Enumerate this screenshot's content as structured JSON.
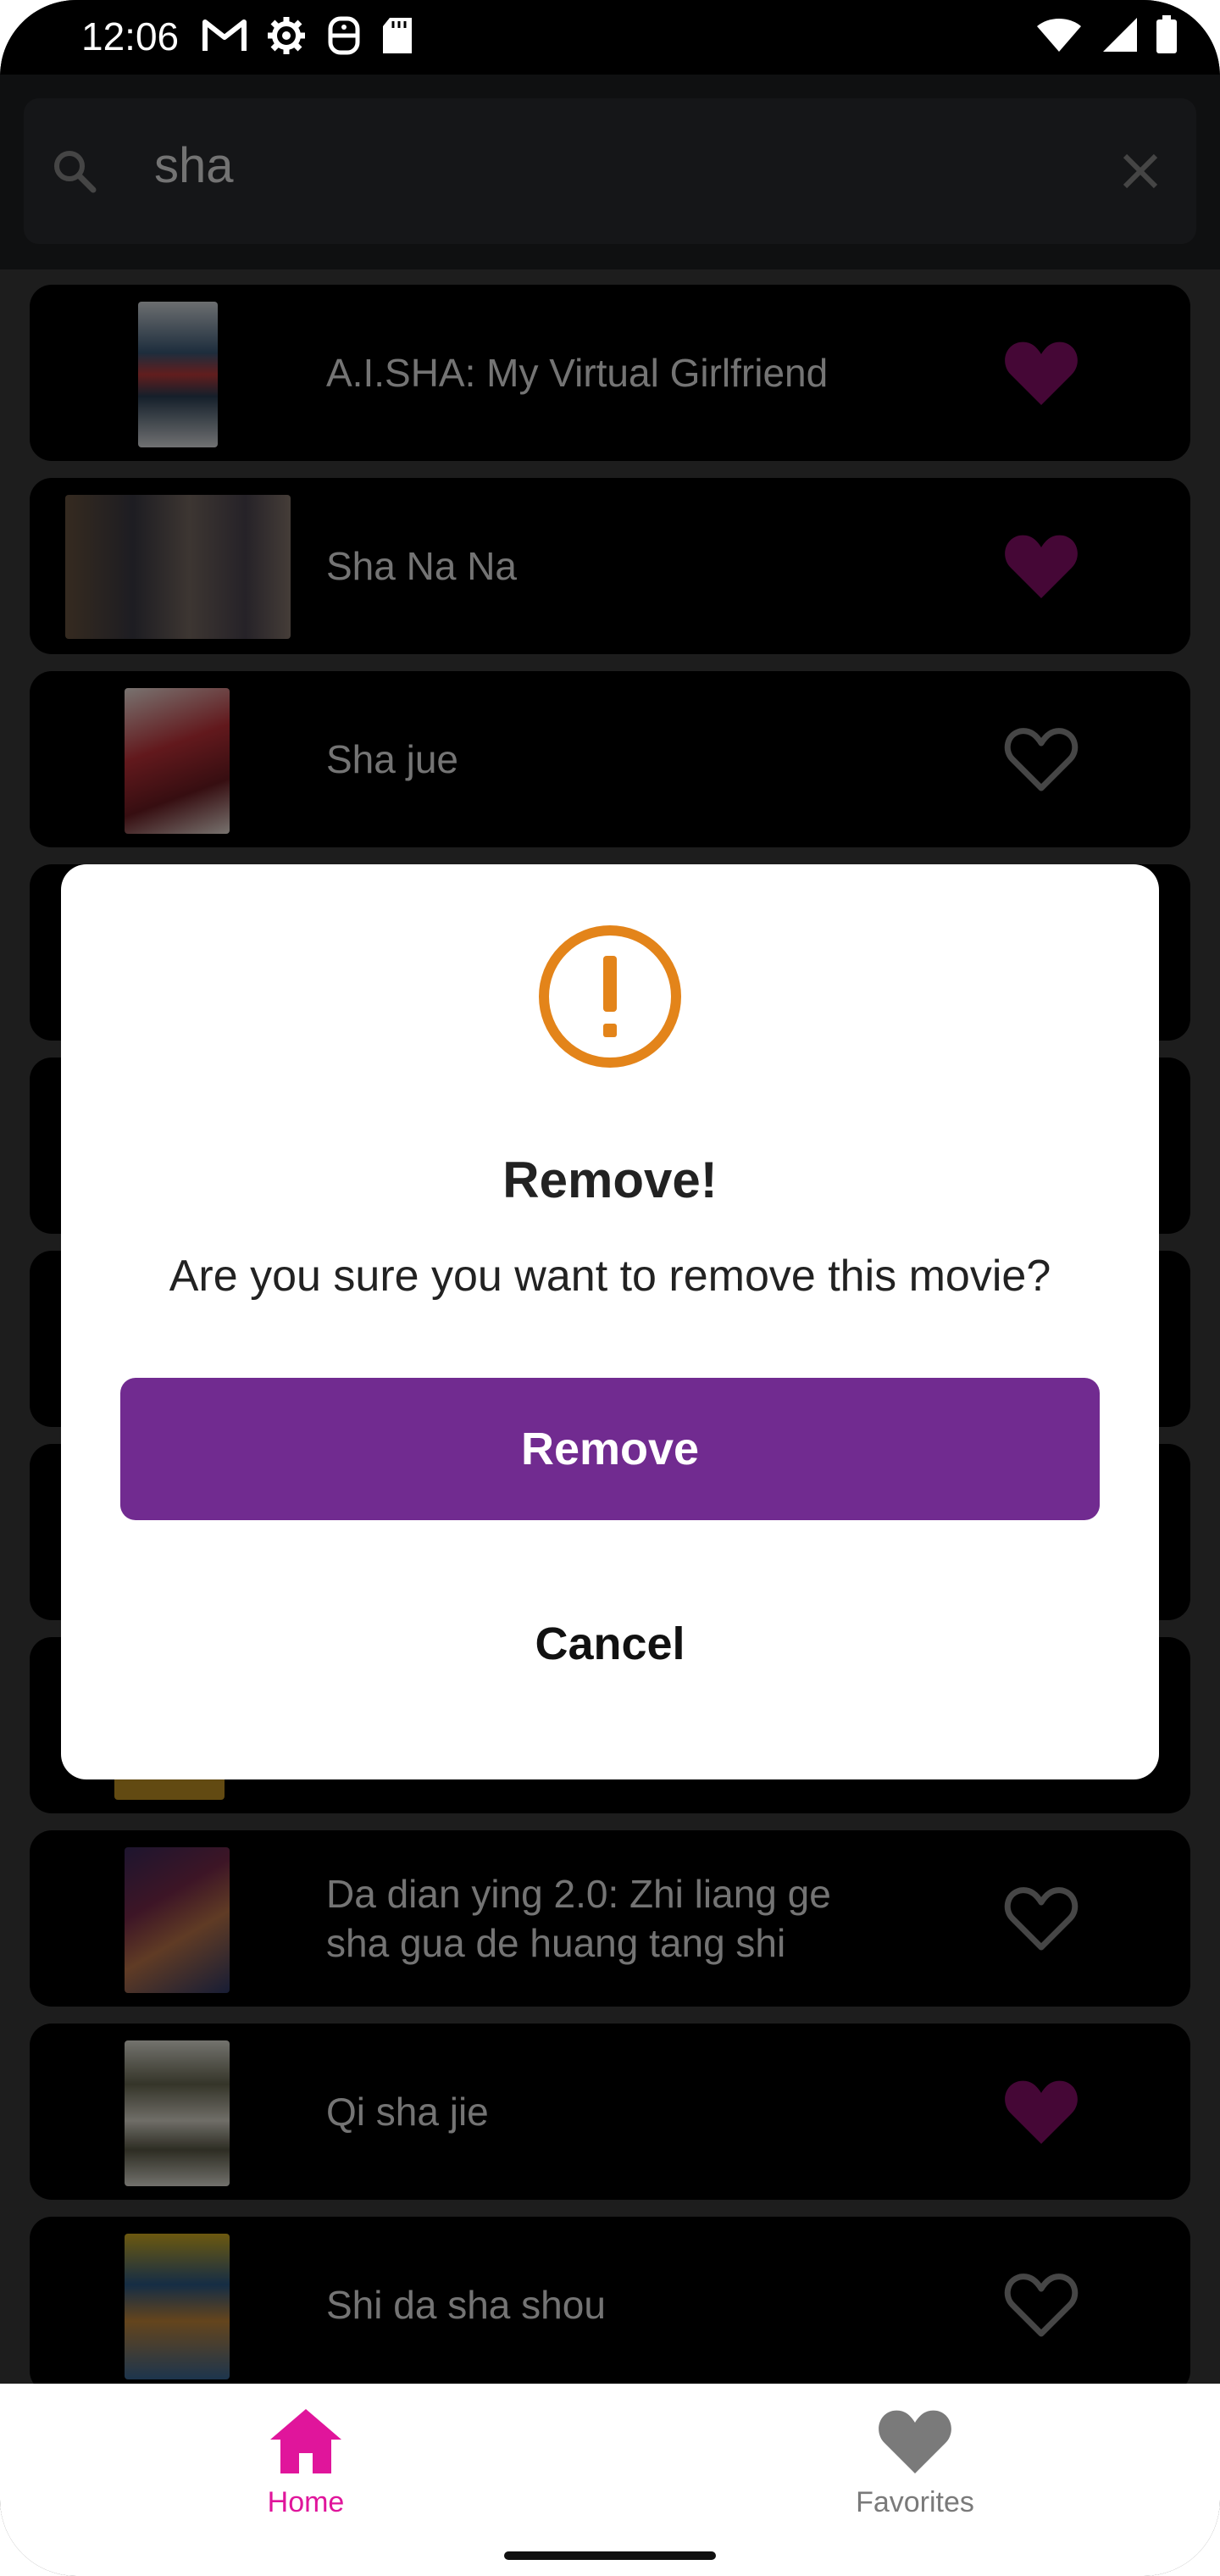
{
  "status_bar": {
    "time": "12:06",
    "left_icons": [
      "gmail-icon",
      "settings-icon",
      "accessibility-icon",
      "sd-card-icon"
    ],
    "right_icons": [
      "wifi-icon",
      "signal-icon",
      "battery-icon"
    ]
  },
  "search": {
    "query": "sha"
  },
  "movies": [
    {
      "title": "A.I.SHA: My Virtual Girlfriend",
      "favorite": true
    },
    {
      "title": "Sha Na Na",
      "favorite": true
    },
    {
      "title": "Sha jue",
      "favorite": false
    },
    {
      "title": "Da dian ying 2.0: Zhi liang ge sha gua de huang tang shi",
      "favorite": false
    },
    {
      "title": "Qi sha jie",
      "favorite": true
    },
    {
      "title": "Shi da sha shou",
      "favorite": false
    }
  ],
  "dialog": {
    "title": "Remove!",
    "message": "Are you sure you want to remove this movie?",
    "confirm_label": "Remove",
    "cancel_label": "Cancel"
  },
  "bottom_nav": {
    "items": [
      {
        "label": "Home",
        "active": true
      },
      {
        "label": "Favorites",
        "active": false
      }
    ]
  },
  "colors": {
    "favorite_active": "#8b0f6d",
    "nav_active": "#e0159b",
    "nav_inactive": "#7a7a7a",
    "dialog_button": "#712b90",
    "warning": "#e3841a"
  }
}
